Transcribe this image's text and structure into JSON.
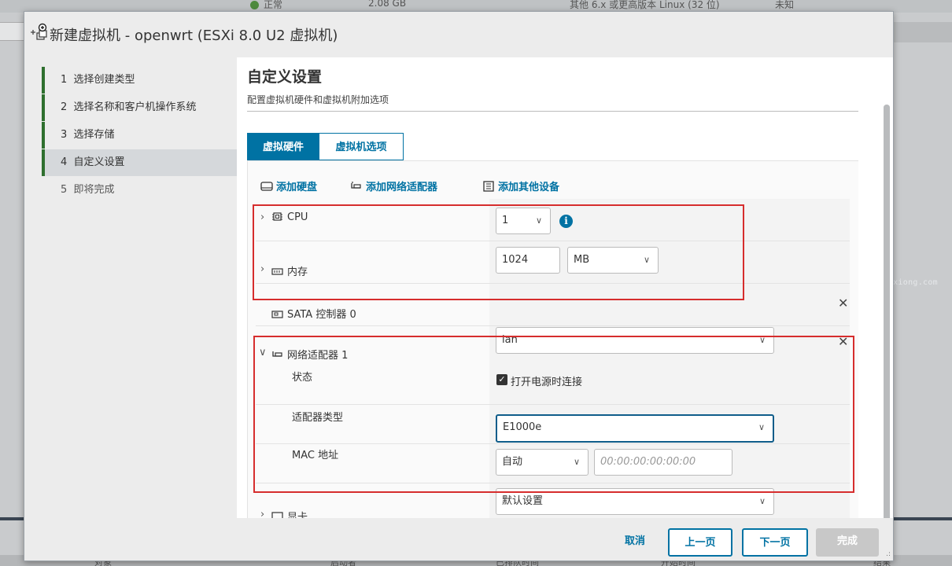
{
  "background": {
    "status": "正常",
    "memory": "2.08 GB",
    "os": "其他 6.x 或更高版本 Linux (32 位)",
    "unknown": "未知",
    "bottom_cols": [
      "对象",
      "启动者",
      "已排队时间",
      "开始时间",
      "结果"
    ],
    "watermark": "Yangkexiong.com"
  },
  "dialog": {
    "title": "新建虚拟机 - openwrt (ESXi 8.0 U2 虚拟机)"
  },
  "steps": [
    {
      "num": "1",
      "label": "选择创建类型",
      "state": "done"
    },
    {
      "num": "2",
      "label": "选择名称和客户机操作系统",
      "state": "done"
    },
    {
      "num": "3",
      "label": "选择存储",
      "state": "done"
    },
    {
      "num": "4",
      "label": "自定义设置",
      "state": "active"
    },
    {
      "num": "5",
      "label": "即将完成",
      "state": "pending"
    }
  ],
  "page": {
    "title": "自定义设置",
    "subtitle": "配置虚拟机硬件和虚拟机附加选项"
  },
  "tabs": {
    "hardware": "虚拟硬件",
    "options": "虚拟机选项"
  },
  "toolbar": {
    "add_disk": "添加硬盘",
    "add_nic": "添加网络适配器",
    "add_other": "添加其他设备"
  },
  "hardware": {
    "cpu": {
      "label": "CPU",
      "value": "1"
    },
    "memory": {
      "label": "内存",
      "value": "1024",
      "unit": "MB"
    },
    "sata": {
      "label": "SATA 控制器 0"
    },
    "nic": {
      "label": "网络适配器 1",
      "network": "lan",
      "status_label": "状态",
      "connect_label": "打开电源时连接",
      "connect_checked": true,
      "type_label": "适配器类型",
      "type_value": "E1000e",
      "mac_label": "MAC 地址",
      "mac_mode": "自动",
      "mac_placeholder": "00:00:00:00:00:00"
    },
    "video": {
      "label": "显卡",
      "value": "默认设置"
    }
  },
  "footer": {
    "cancel": "取消",
    "prev": "上一页",
    "next": "下一页",
    "finish": "完成"
  },
  "colors": {
    "accent": "#0072a3",
    "step_done": "#2e6f2e",
    "highlight": "#d62d2d"
  }
}
